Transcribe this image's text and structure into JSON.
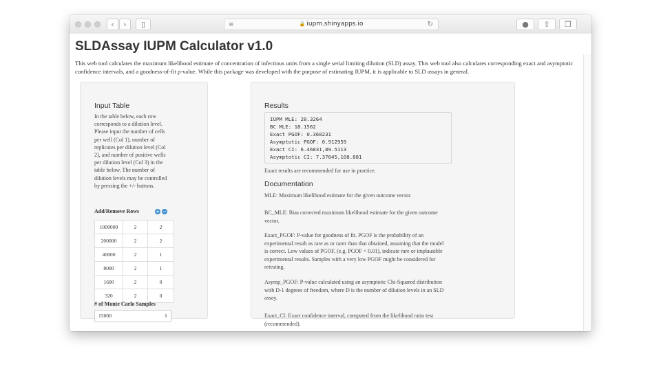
{
  "browser": {
    "url": "iupm.shinyapps.io"
  },
  "page": {
    "title": "SLDAssay IUPM Calculator v1.0",
    "intro": "This web tool calculates the maximum likelihood estimate of concentration of infectious units from a single serial limiting dilution (SLD) assay. This web tool also calculates corresponding exact and asymptotic confidence intervals, and a goodness-of-fit p-value. While this package was developed with the purpose of estimating IUPM, it is applicable to SLD assays in general."
  },
  "sidebar": {
    "heading": "Input Table",
    "instructions": "In the table below, each row corresponds to a dilution level. Please input the number of cells per well (Col 1), number of replicates per dilution level (Col 2), and number of positive wells per dilution level (Col 3) in the table below. The number of dilution levels may be controlled by pressing the +/- buttons.",
    "add_remove_label": "Add/Remove Rows",
    "add_symbol": "+",
    "remove_symbol": "−",
    "table": [
      [
        "1000000",
        "2",
        "2"
      ],
      [
        "200000",
        "2",
        "2"
      ],
      [
        "40000",
        "2",
        "1"
      ],
      [
        "8000",
        "2",
        "1"
      ],
      [
        "1600",
        "2",
        "0"
      ],
      [
        "320",
        "2",
        "0"
      ]
    ],
    "mc_label": "# of Monte Carlo Samples",
    "mc_value": "15000"
  },
  "results": {
    "heading": "Results",
    "lines": [
      "IUPM MLE: 28.3264",
      "BC MLE: 18.1562",
      "Exact PGOF: 0.360231",
      "Asymptotic PGOF: 0.912959",
      "Exact CI: 6.46831,89.5113",
      "Asymptotic CI: 7.37045,108.881"
    ],
    "note": "Exact results are recommended for use in practice."
  },
  "documentation": {
    "heading": "Documentation",
    "paragraphs": [
      "MLE: Maximum likelihood estimate for the given outcome vector.",
      "BC_MLE: Bias corrected maximum likelihood estimate for the given outcome vector.",
      "Exact_PGOF: P-value for goodness of fit. PGOF is the probability of an experimental result as rare as or rarer than that obtained, assuming that the model is correct. Low values of PGOF, (e.g. PGOF < 0.01), indicate rare or implausible experimental results. Samples with a very low PGOF might be considered for retesting.",
      "Asymp_PGOF: P-value calculated using an asymptotic Chi-Squared distribution with D-1 degrees of freedom, where D is the number of dilution levels in an SLD assay.",
      "Exact_CI: Exact confidence interval, computed from the likelihood ratio test (recommended)."
    ]
  }
}
